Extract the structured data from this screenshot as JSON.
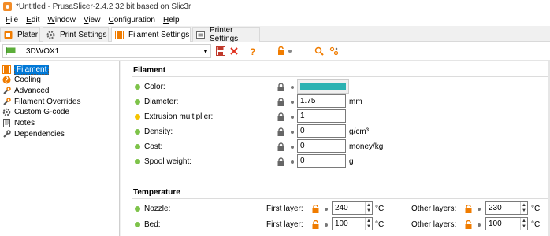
{
  "window": {
    "title": "*Untitled - PrusaSlicer-2.4.2 32 bit based on Slic3r"
  },
  "menu": [
    {
      "key": "F",
      "rest": "ile"
    },
    {
      "key": "E",
      "rest": "dit"
    },
    {
      "key": "W",
      "rest": "indow"
    },
    {
      "key": "V",
      "rest": "iew"
    },
    {
      "key": "C",
      "rest": "onfiguration"
    },
    {
      "key": "H",
      "rest": "elp"
    }
  ],
  "tabs": {
    "plater": "Plater",
    "print": "Print Settings",
    "filament": "Filament Settings",
    "printer": "Printer Settings",
    "active": "filament"
  },
  "preset": {
    "name": "3DWOX1"
  },
  "sidebar": {
    "items": [
      {
        "label": "Filament",
        "icon": "filament-spool-icon",
        "selected": true
      },
      {
        "label": "Cooling",
        "icon": "cooling-fan-icon"
      },
      {
        "label": "Advanced",
        "icon": "advanced-wrench-icon"
      },
      {
        "label": "Filament Overrides",
        "icon": "overrides-wrench-icon"
      },
      {
        "label": "Custom G-code",
        "icon": "gcode-cog-icon"
      },
      {
        "label": "Notes",
        "icon": "notes-icon"
      },
      {
        "label": "Dependencies",
        "icon": "dependencies-wrench-icon"
      }
    ]
  },
  "filament": {
    "title": "Filament",
    "color": {
      "label": "Color:",
      "value_hex": "#2bb2b2"
    },
    "diameter": {
      "label": "Diameter:",
      "value": "1.75",
      "unit": "mm"
    },
    "extrusion_multiplier": {
      "label": "Extrusion multiplier:",
      "value": "1"
    },
    "density": {
      "label": "Density:",
      "value": "0",
      "unit": "g/cm³"
    },
    "cost": {
      "label": "Cost:",
      "value": "0",
      "unit": "money/kg"
    },
    "spool_weight": {
      "label": "Spool weight:",
      "value": "0",
      "unit": "g"
    }
  },
  "temperature": {
    "title": "Temperature",
    "first_layer_label": "First layer:",
    "other_layers_label": "Other layers:",
    "nozzle": {
      "label": "Nozzle:",
      "first_layer": "240",
      "other_layers": "230",
      "unit": "°C"
    },
    "bed": {
      "label": "Bed:",
      "first_layer": "100",
      "other_layers": "100",
      "unit": "°C"
    }
  },
  "colors": {
    "accent": "#0078d7",
    "status_green": "#7ec34a",
    "status_yellow": "#f5c400",
    "lock_orange": "#f07c00",
    "filament_color": "#2bb2b2"
  }
}
